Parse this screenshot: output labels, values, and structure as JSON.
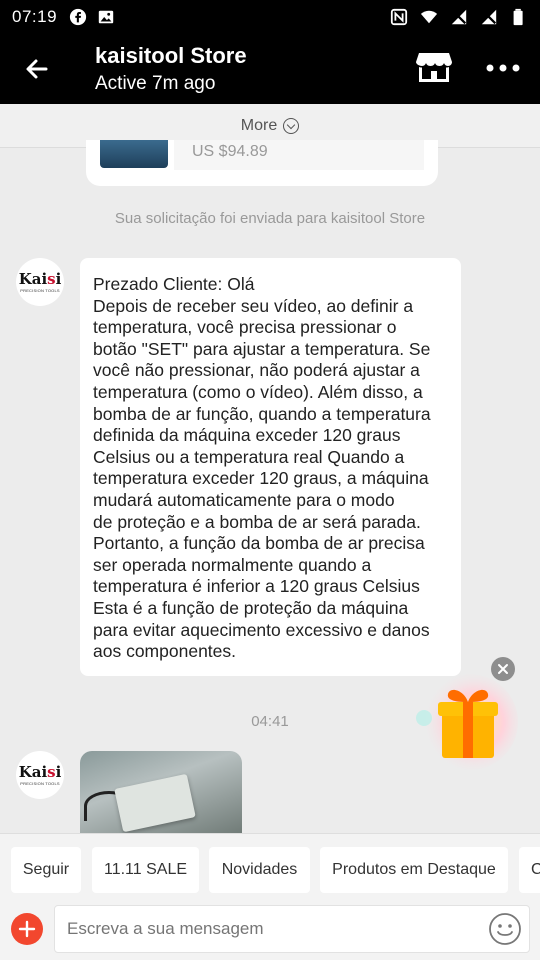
{
  "status_bar": {
    "time": "07:19",
    "left_icons": [
      "facebook-icon",
      "image-icon"
    ],
    "right_icons": [
      "nfc-icon",
      "wifi-icon",
      "signal-off-icon",
      "signal-off-icon",
      "battery-icon"
    ]
  },
  "header": {
    "store_name": "kaisitool Store",
    "active_status": "Active 7m ago"
  },
  "more_bar": {
    "label": "More"
  },
  "product": {
    "price": "US $94.89"
  },
  "system_message": "Sua solicitação foi enviada para kaisitool Store",
  "avatar": {
    "brand_main": "Kai",
    "brand_accent": "s",
    "brand_end": "i",
    "subtitle": "PRECISION TOOLS"
  },
  "message_text": "Prezado Cliente: Olá\nDepois de receber seu vídeo, ao definir a\ntemperatura, você precisa pressionar o\nbotão \"SET\" para ajustar a temperatura. Se\nvocê não pressionar, não poderá ajustar a\ntemperatura (como o vídeo). Além disso, a\nbomba de ar função, quando a temperatura\ndefinida da máquina exceder 120 graus\nCelsius ou a temperatura real Quando a\ntemperatura exceder 120 graus, a máquina\nmudará automaticamente para o modo\nde proteção e a bomba de ar será parada.\nPortanto, a função da bomba de ar precisa\nser operada normalmente quando a\ntemperatura é inferior a 120 graus Celsius\nEsta é a função de proteção da máquina\npara evitar aquecimento excessivo e danos\naos componentes.",
  "timestamp": "04:41",
  "chips": [
    "Seguir",
    "11.11 SALE",
    "Novidades",
    "Produtos em Destaque",
    "C"
  ],
  "input": {
    "placeholder": "Escreva a sua mensagem"
  },
  "colors": {
    "header_bg": "#000000",
    "accent_red": "#f2472e",
    "chat_bg": "#ececec"
  }
}
